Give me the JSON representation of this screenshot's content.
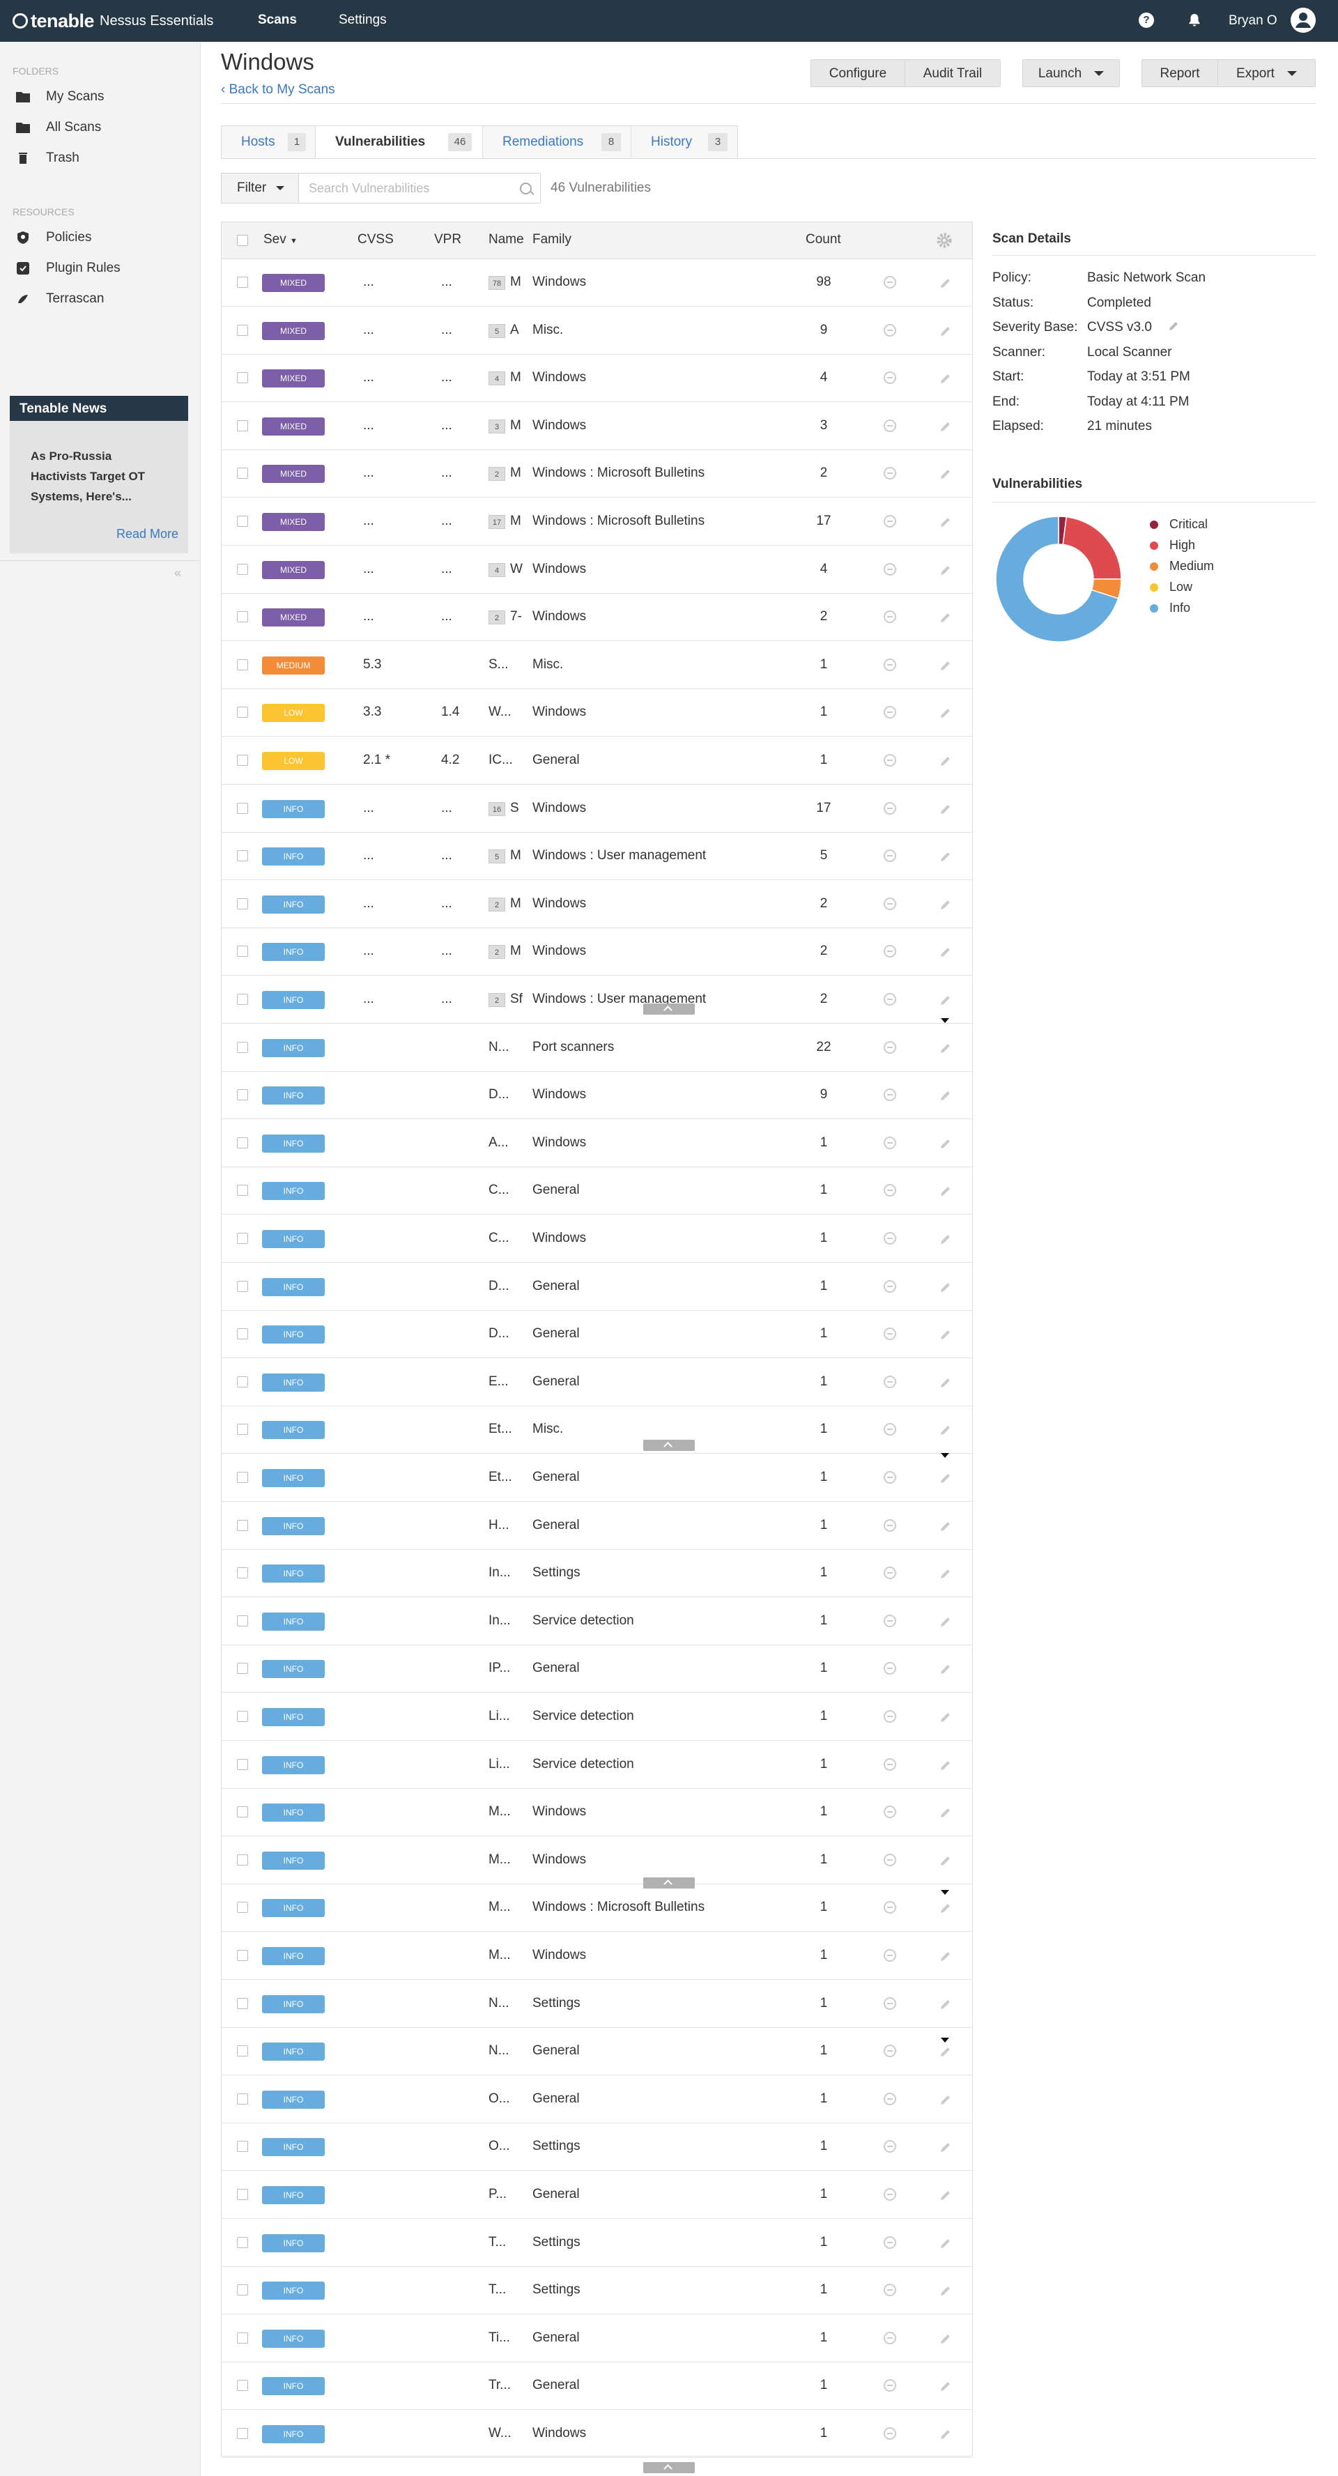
{
  "topbar": {
    "brand": "tenable",
    "product": "Nessus Essentials",
    "nav_scans": "Scans",
    "nav_settings": "Settings",
    "user_name": "Bryan O"
  },
  "sidebar": {
    "folders_heading": "FOLDERS",
    "folders": [
      {
        "label": "My Scans",
        "icon": "folder-icon"
      },
      {
        "label": "All Scans",
        "icon": "folder-icon"
      },
      {
        "label": "Trash",
        "icon": "trash-icon"
      }
    ],
    "resources_heading": "RESOURCES",
    "resources": [
      {
        "label": "Policies",
        "icon": "shield-icon"
      },
      {
        "label": "Plugin Rules",
        "icon": "plugin-icon"
      },
      {
        "label": "Terrascan",
        "icon": "terrascan-icon"
      }
    ],
    "news": {
      "heading": "Tenable News",
      "title": "As Pro-Russia Hactivists Target OT Systems, Here's...",
      "read_more": "Read More"
    }
  },
  "page": {
    "title": "Windows",
    "back_link": "Back to My Scans",
    "buttons": {
      "configure": "Configure",
      "audit_trail": "Audit Trail",
      "launch": "Launch",
      "report": "Report",
      "export": "Export"
    }
  },
  "tabs": [
    {
      "label": "Hosts",
      "count": "1"
    },
    {
      "label": "Vulnerabilities",
      "count": "46"
    },
    {
      "label": "Remediations",
      "count": "8"
    },
    {
      "label": "History",
      "count": "3"
    }
  ],
  "filter": {
    "label": "Filter",
    "search_placeholder": "Search Vulnerabilities",
    "count_text": "46 Vulnerabilities"
  },
  "table": {
    "headers": {
      "sev": "Sev",
      "cvss": "CVSS",
      "vpr": "VPR",
      "name": "Name",
      "family": "Family",
      "count": "Count"
    },
    "rows": [
      {
        "sev": "MIXED",
        "cvss": "...",
        "vpr": "...",
        "grp": "78",
        "name": "M",
        "family": "Windows",
        "count": "98"
      },
      {
        "sev": "MIXED",
        "cvss": "...",
        "vpr": "...",
        "grp": "5",
        "name": "A",
        "family": "Misc.",
        "count": "9"
      },
      {
        "sev": "MIXED",
        "cvss": "...",
        "vpr": "...",
        "grp": "4",
        "name": "M",
        "family": "Windows",
        "count": "4"
      },
      {
        "sev": "MIXED",
        "cvss": "...",
        "vpr": "...",
        "grp": "3",
        "name": "M",
        "family": "Windows",
        "count": "3"
      },
      {
        "sev": "MIXED",
        "cvss": "...",
        "vpr": "...",
        "grp": "2",
        "name": "M",
        "family": "Windows : Microsoft Bulletins",
        "count": "2"
      },
      {
        "sev": "MIXED",
        "cvss": "...",
        "vpr": "...",
        "grp": "17",
        "name": "M",
        "family": "Windows : Microsoft Bulletins",
        "count": "17"
      },
      {
        "sev": "MIXED",
        "cvss": "...",
        "vpr": "...",
        "grp": "4",
        "name": "W",
        "family": "Windows",
        "count": "4"
      },
      {
        "sev": "MIXED",
        "cvss": "...",
        "vpr": "...",
        "grp": "2",
        "name": "7-",
        "family": "Windows",
        "count": "2"
      },
      {
        "sev": "MEDIUM",
        "cvss": "5.3",
        "vpr": "",
        "grp": "",
        "name": "S...",
        "family": "Misc.",
        "count": "1"
      },
      {
        "sev": "LOW",
        "cvss": "3.3",
        "vpr": "1.4",
        "grp": "",
        "name": "W...",
        "family": "Windows",
        "count": "1"
      },
      {
        "sev": "LOW",
        "cvss": "2.1 *",
        "vpr": "4.2",
        "grp": "",
        "name": "IC...",
        "family": "General",
        "count": "1"
      },
      {
        "sev": "INFO",
        "cvss": "...",
        "vpr": "...",
        "grp": "16",
        "name": "S",
        "family": "Windows",
        "count": "17"
      },
      {
        "sev": "INFO",
        "cvss": "...",
        "vpr": "...",
        "grp": "5",
        "name": "M",
        "family": "Windows : User management",
        "count": "5"
      },
      {
        "sev": "INFO",
        "cvss": "...",
        "vpr": "...",
        "grp": "2",
        "name": "M",
        "family": "Windows",
        "count": "2"
      },
      {
        "sev": "INFO",
        "cvss": "...",
        "vpr": "...",
        "grp": "2",
        "name": "M",
        "family": "Windows",
        "count": "2"
      },
      {
        "sev": "INFO",
        "cvss": "...",
        "vpr": "...",
        "grp": "2",
        "name": "Sf",
        "family": "Windows : User management",
        "count": "2"
      },
      {
        "sev": "INFO",
        "cvss": "",
        "vpr": "",
        "grp": "",
        "name": "N...",
        "family": "Port scanners",
        "count": "22"
      },
      {
        "sev": "INFO",
        "cvss": "",
        "vpr": "",
        "grp": "",
        "name": "D...",
        "family": "Windows",
        "count": "9"
      },
      {
        "sev": "INFO",
        "cvss": "",
        "vpr": "",
        "grp": "",
        "name": "A...",
        "family": "Windows",
        "count": "1"
      },
      {
        "sev": "INFO",
        "cvss": "",
        "vpr": "",
        "grp": "",
        "name": "C...",
        "family": "General",
        "count": "1"
      },
      {
        "sev": "INFO",
        "cvss": "",
        "vpr": "",
        "grp": "",
        "name": "C...",
        "family": "Windows",
        "count": "1"
      },
      {
        "sev": "INFO",
        "cvss": "",
        "vpr": "",
        "grp": "",
        "name": "D...",
        "family": "General",
        "count": "1"
      },
      {
        "sev": "INFO",
        "cvss": "",
        "vpr": "",
        "grp": "",
        "name": "D...",
        "family": "General",
        "count": "1"
      },
      {
        "sev": "INFO",
        "cvss": "",
        "vpr": "",
        "grp": "",
        "name": "E...",
        "family": "General",
        "count": "1"
      },
      {
        "sev": "INFO",
        "cvss": "",
        "vpr": "",
        "grp": "",
        "name": "Et...",
        "family": "Misc.",
        "count": "1"
      },
      {
        "sev": "INFO",
        "cvss": "",
        "vpr": "",
        "grp": "",
        "name": "Et...",
        "family": "General",
        "count": "1"
      },
      {
        "sev": "INFO",
        "cvss": "",
        "vpr": "",
        "grp": "",
        "name": "H...",
        "family": "General",
        "count": "1"
      },
      {
        "sev": "INFO",
        "cvss": "",
        "vpr": "",
        "grp": "",
        "name": "In...",
        "family": "Settings",
        "count": "1"
      },
      {
        "sev": "INFO",
        "cvss": "",
        "vpr": "",
        "grp": "",
        "name": "In...",
        "family": "Service detection",
        "count": "1"
      },
      {
        "sev": "INFO",
        "cvss": "",
        "vpr": "",
        "grp": "",
        "name": "IP...",
        "family": "General",
        "count": "1"
      },
      {
        "sev": "INFO",
        "cvss": "",
        "vpr": "",
        "grp": "",
        "name": "Li...",
        "family": "Service detection",
        "count": "1"
      },
      {
        "sev": "INFO",
        "cvss": "",
        "vpr": "",
        "grp": "",
        "name": "Li...",
        "family": "Service detection",
        "count": "1"
      },
      {
        "sev": "INFO",
        "cvss": "",
        "vpr": "",
        "grp": "",
        "name": "M...",
        "family": "Windows",
        "count": "1"
      },
      {
        "sev": "INFO",
        "cvss": "",
        "vpr": "",
        "grp": "",
        "name": "M...",
        "family": "Windows",
        "count": "1"
      },
      {
        "sev": "INFO",
        "cvss": "",
        "vpr": "",
        "grp": "",
        "name": "M...",
        "family": "Windows : Microsoft Bulletins",
        "count": "1"
      },
      {
        "sev": "INFO",
        "cvss": "",
        "vpr": "",
        "grp": "",
        "name": "M...",
        "family": "Windows",
        "count": "1"
      },
      {
        "sev": "INFO",
        "cvss": "",
        "vpr": "",
        "grp": "",
        "name": "N...",
        "family": "Settings",
        "count": "1"
      },
      {
        "sev": "INFO",
        "cvss": "",
        "vpr": "",
        "grp": "",
        "name": "N...",
        "family": "General",
        "count": "1"
      },
      {
        "sev": "INFO",
        "cvss": "",
        "vpr": "",
        "grp": "",
        "name": "O...",
        "family": "General",
        "count": "1"
      },
      {
        "sev": "INFO",
        "cvss": "",
        "vpr": "",
        "grp": "",
        "name": "O...",
        "family": "Settings",
        "count": "1"
      },
      {
        "sev": "INFO",
        "cvss": "",
        "vpr": "",
        "grp": "",
        "name": "P...",
        "family": "General",
        "count": "1"
      },
      {
        "sev": "INFO",
        "cvss": "",
        "vpr": "",
        "grp": "",
        "name": "T...",
        "family": "Settings",
        "count": "1"
      },
      {
        "sev": "INFO",
        "cvss": "",
        "vpr": "",
        "grp": "",
        "name": "T...",
        "family": "Settings",
        "count": "1"
      },
      {
        "sev": "INFO",
        "cvss": "",
        "vpr": "",
        "grp": "",
        "name": "Ti...",
        "family": "General",
        "count": "1"
      },
      {
        "sev": "INFO",
        "cvss": "",
        "vpr": "",
        "grp": "",
        "name": "Tr...",
        "family": "General",
        "count": "1"
      },
      {
        "sev": "INFO",
        "cvss": "",
        "vpr": "",
        "grp": "",
        "name": "W...",
        "family": "Windows",
        "count": "1"
      }
    ]
  },
  "severity_colors": {
    "MIXED": "#7b5ea7",
    "MEDIUM": "#f28c38",
    "LOW": "#fdc431",
    "INFO": "#67acdf",
    "CRITICAL": "#91243e",
    "HIGH": "#dd4b50"
  },
  "scan_details": {
    "heading": "Scan Details",
    "fields": [
      {
        "key": "Policy:",
        "value": "Basic Network Scan"
      },
      {
        "key": "Status:",
        "value": "Completed"
      },
      {
        "key": "Severity Base:",
        "value": "CVSS v3.0"
      },
      {
        "key": "Scanner:",
        "value": "Local Scanner"
      },
      {
        "key": "Start:",
        "value": "Today at 3:51 PM"
      },
      {
        "key": "End:",
        "value": "Today at 4:11 PM"
      },
      {
        "key": "Elapsed:",
        "value": "21 minutes"
      }
    ]
  },
  "vuln_chart": {
    "heading": "Vulnerabilities",
    "slices": [
      {
        "label": "Critical",
        "value": 2,
        "color": "#91243e"
      },
      {
        "label": "High",
        "value": 23,
        "color": "#dd4b50"
      },
      {
        "label": "Medium",
        "value": 5,
        "color": "#f28c38"
      },
      {
        "label": "Low",
        "value": 0,
        "color": "#fdc431"
      },
      {
        "label": "Info",
        "value": 70,
        "color": "#67acdf"
      }
    ]
  }
}
